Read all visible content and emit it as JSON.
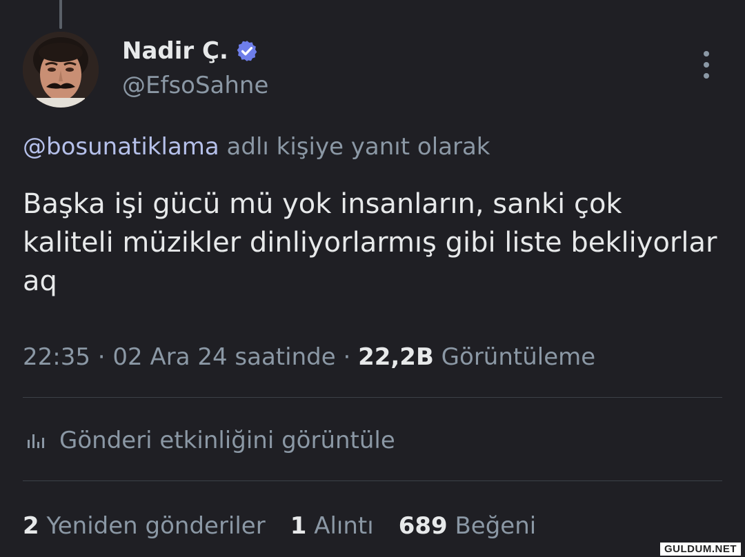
{
  "author": {
    "display_name": "Nadir Ç.",
    "handle": "@EfsoSahne",
    "verified_icon": "verified-badge-icon",
    "verified_color": "#6e7eea"
  },
  "reply": {
    "mention": "@bosunatiklama",
    "suffix": " adlı kişiye yanıt olarak"
  },
  "tweet": {
    "text": "Başka işi gücü mü yok insanların, sanki çok kaliteli müzikler dinliyorlarmış gibi liste bekliyorlar aq"
  },
  "meta": {
    "time_date": "22:35 · 02 Ara 24 saatinde · ",
    "views_count": "22,2B",
    "views_label": " Görüntüleme"
  },
  "activity": {
    "icon": "analytics-icon",
    "label": "Gönderi etkinliğini görüntüle"
  },
  "stats": {
    "reposts_count": "2",
    "reposts_label": "Yeniden gönderiler",
    "quotes_count": "1",
    "quotes_label": "Alıntı",
    "likes_count": "689",
    "likes_label": "Beğeni"
  },
  "watermark": "GULDUM.NET"
}
